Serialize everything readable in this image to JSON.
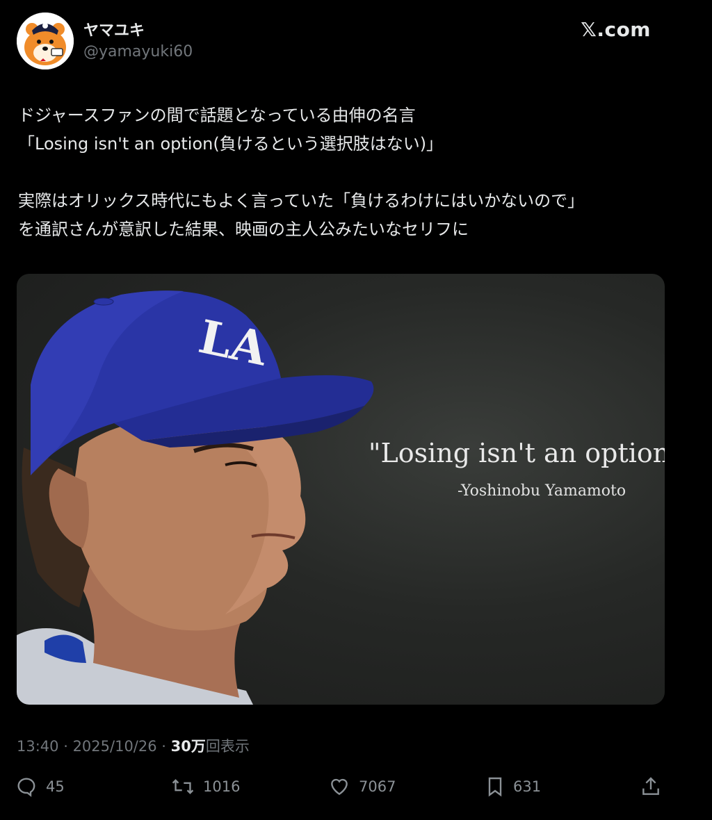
{
  "author": {
    "display_name": "ヤマユキ",
    "handle": "@yamayuki60",
    "avatar_icon": "tanuki-mascot-avatar"
  },
  "brand": "𝕏.com",
  "tweet": {
    "lines": [
      "ドジャースファンの間で話題となっている由伸の名言",
      "「Losing isn't an option(負けるという選択肢はない)」",
      "",
      "実際はオリックス時代にもよく言っていた「負けるわけにはいかないので」",
      "を通訳さんが意訳した結果、映画の主人公みたいなセリフに"
    ]
  },
  "media": {
    "quote": "\"Losing isn't an option\"",
    "attribution": "-Yoshinobu Yamamoto",
    "cap_logo": "LA",
    "cap_color": "#2a35a6"
  },
  "meta": {
    "time": "13:40",
    "date": "2025/10/26",
    "views_count": "30万",
    "views_label": "回表示"
  },
  "actions": {
    "reply_count": "45",
    "retweet_count": "1016",
    "like_count": "7067",
    "bookmark_count": "631"
  }
}
